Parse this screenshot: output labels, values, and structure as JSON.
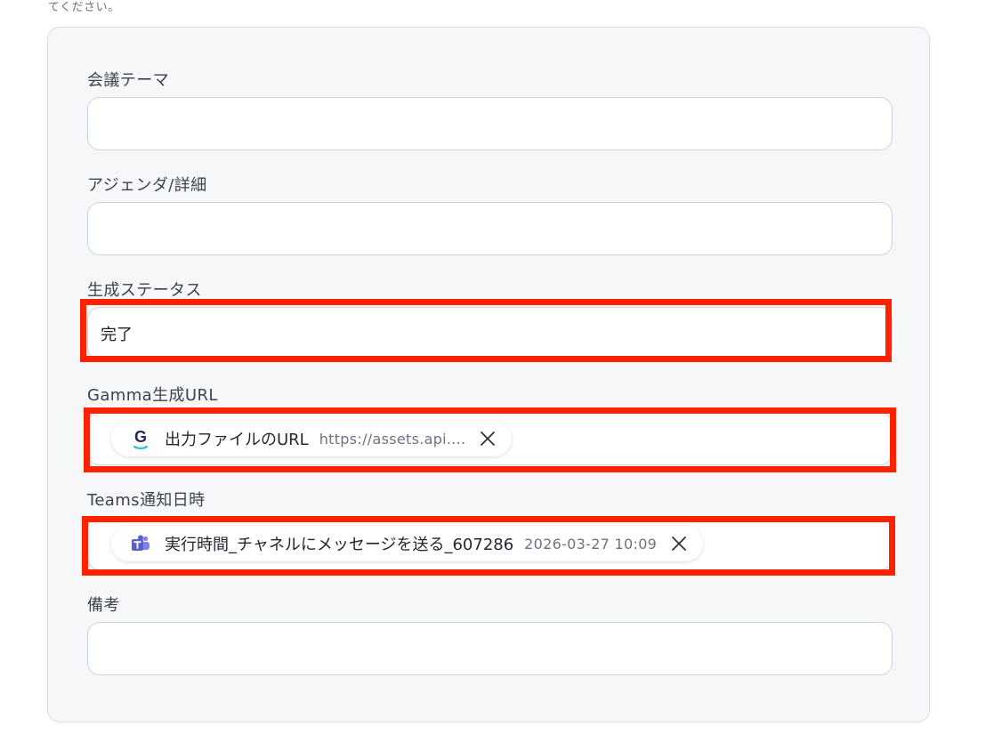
{
  "top_note": "てください。",
  "form": {
    "fields": [
      {
        "label": "会議テーマ",
        "value": ""
      },
      {
        "label": "アジェンダ/詳細",
        "value": ""
      },
      {
        "label": "生成ステータス",
        "value": "完了"
      },
      {
        "label": "Gamma生成URL",
        "chip": {
          "icon": "gamma-logo-icon",
          "label": "出力ファイルのURL",
          "value": "https://assets.api...."
        }
      },
      {
        "label": "Teams通知日時",
        "chip": {
          "icon": "teams-logo-icon",
          "label": "実行時間_チャネルにメッセージを送る_607286",
          "value": "2026-03-27 10:09"
        }
      },
      {
        "label": "備考",
        "value": ""
      }
    ]
  },
  "colors": {
    "highlight": "#ff2200",
    "panel_bg": "#f6f7f9",
    "teams_purple": "#5b5fc7",
    "gamma_navy": "#1f2a5a"
  }
}
